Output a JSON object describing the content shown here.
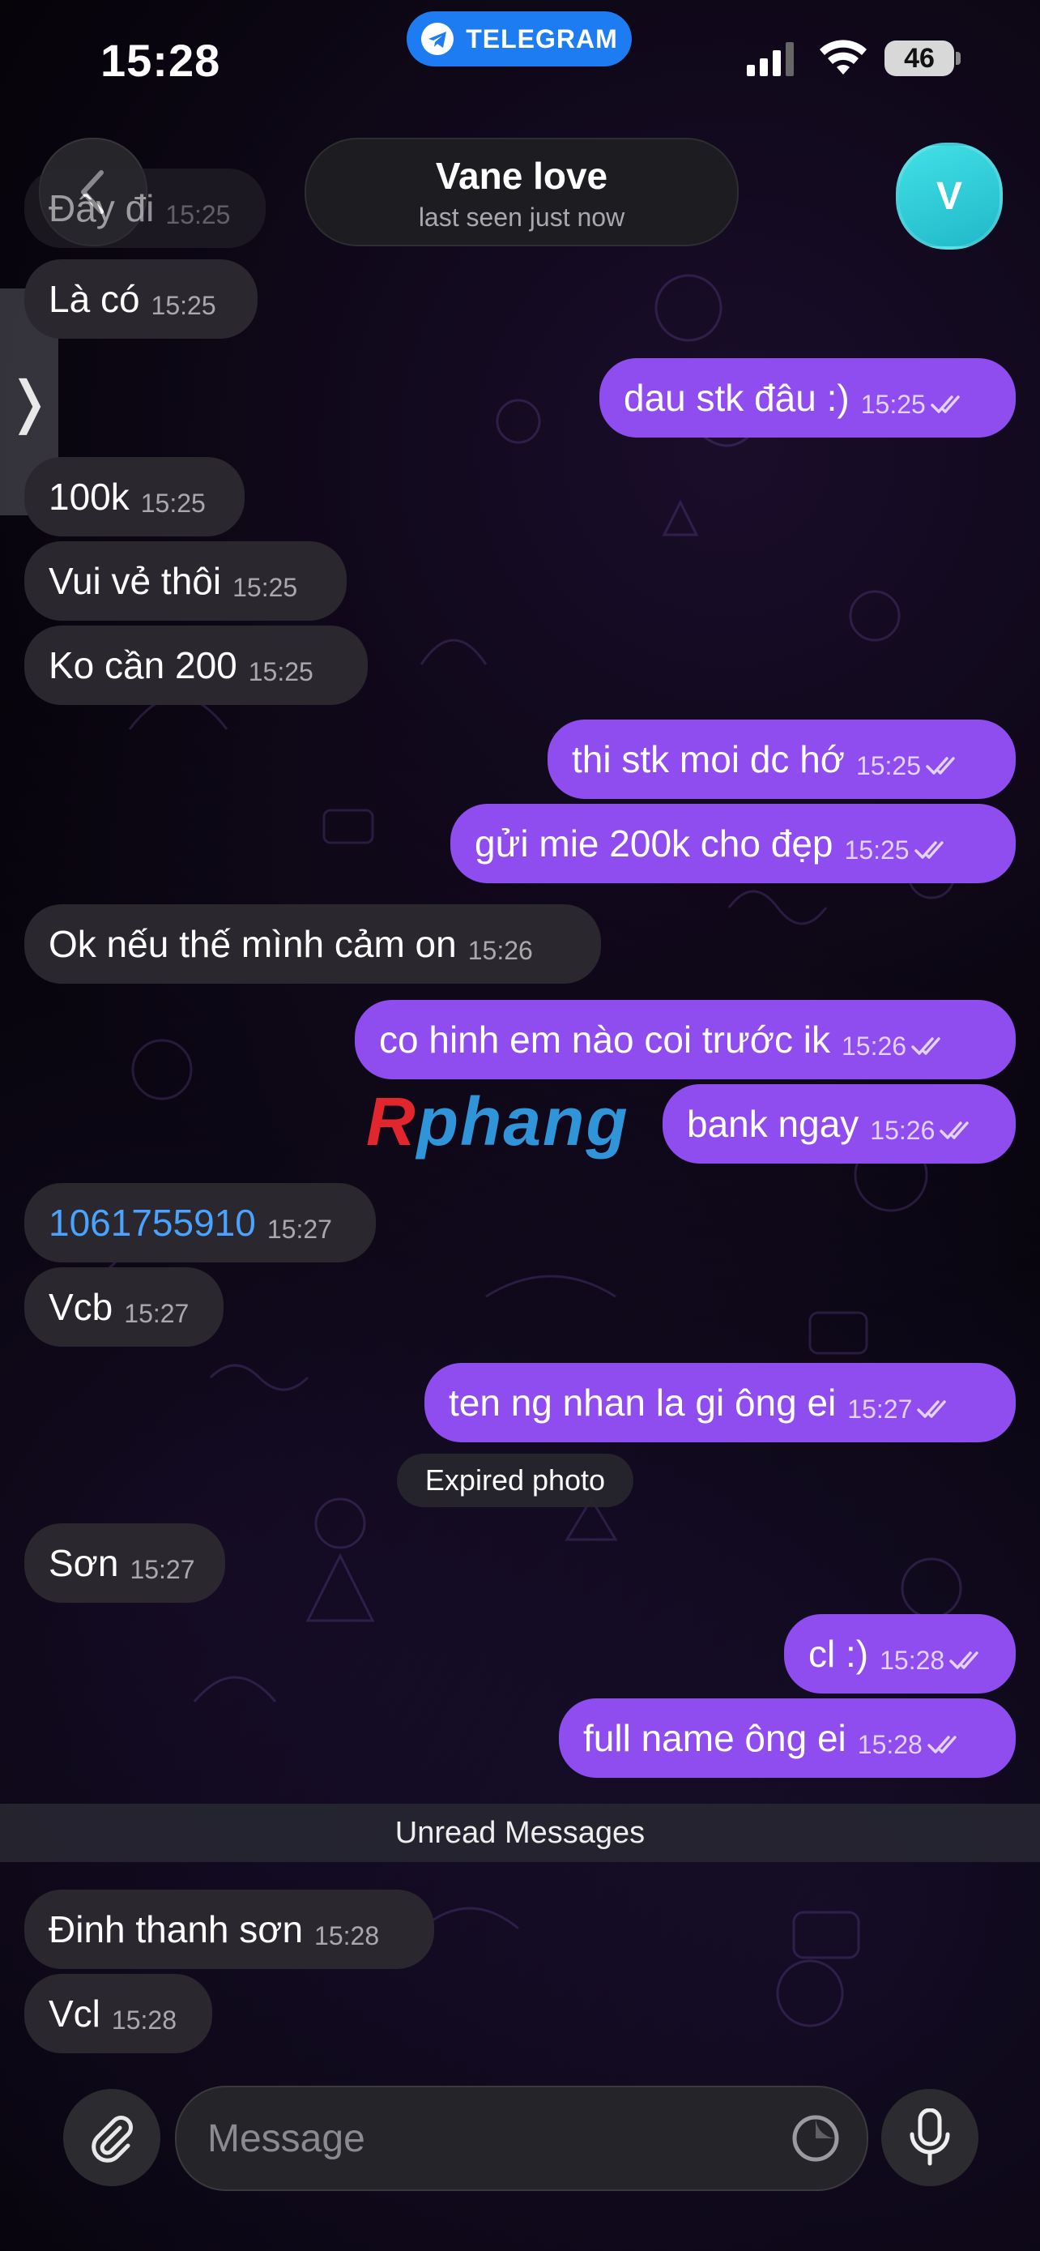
{
  "status_bar": {
    "time": "15:28",
    "app_pill": "TELEGRAM",
    "battery": "46"
  },
  "header": {
    "name": "Vane love",
    "status": "last seen just now",
    "avatar_letter": "V"
  },
  "messages": [
    {
      "dir": "in",
      "text": "Đây đi",
      "time": "15:25"
    },
    {
      "dir": "in",
      "text": "Là có",
      "time": "15:25"
    },
    {
      "dir": "out",
      "text": "dau stk đâu :)",
      "time": "15:25"
    },
    {
      "dir": "in",
      "text": "100k",
      "time": "15:25"
    },
    {
      "dir": "in",
      "text": "Vui vẻ thôi",
      "time": "15:25"
    },
    {
      "dir": "in",
      "text": "Ko cần 200",
      "time": "15:25"
    },
    {
      "dir": "out",
      "text": "thi stk moi dc hớ",
      "time": "15:25"
    },
    {
      "dir": "out",
      "text": "gửi mie 200k cho đẹp",
      "time": "15:25"
    },
    {
      "dir": "in",
      "text": "Ok nếu thế mình cảm on",
      "time": "15:26"
    },
    {
      "dir": "out",
      "text": "co hinh em nào coi trước ik",
      "time": "15:26"
    },
    {
      "dir": "out",
      "text": "bank ngay",
      "time": "15:26"
    },
    {
      "dir": "in",
      "text": "1061755910",
      "time": "15:27"
    },
    {
      "dir": "in",
      "text": "Vcb",
      "time": "15:27"
    },
    {
      "dir": "out",
      "text": "ten ng nhan la gi ông ei",
      "time": "15:27"
    },
    {
      "dir": "in",
      "text": "Sơn",
      "time": "15:27"
    },
    {
      "dir": "out",
      "text": "cl :)",
      "time": "15:28"
    },
    {
      "dir": "out",
      "text": "full name ông ei",
      "time": "15:28"
    },
    {
      "dir": "in",
      "text": "Đinh thanh sơn",
      "time": "15:28"
    },
    {
      "dir": "in",
      "text": "Vcl",
      "time": "15:28"
    }
  ],
  "service_message": "Expired photo",
  "unread_divider": "Unread Messages",
  "watermark": {
    "part1": "R",
    "part2": "phang"
  },
  "composer": {
    "placeholder": "Message"
  },
  "colors": {
    "outgoing": "#8f4df0",
    "incoming": "#2a272e",
    "link": "#4aa3ff",
    "telegram": "#1e7cf2"
  },
  "icons": [
    "telegram-icon",
    "back-chevron-icon",
    "attach-icon",
    "sticker-icon",
    "mic-icon",
    "double-check-icon"
  ]
}
